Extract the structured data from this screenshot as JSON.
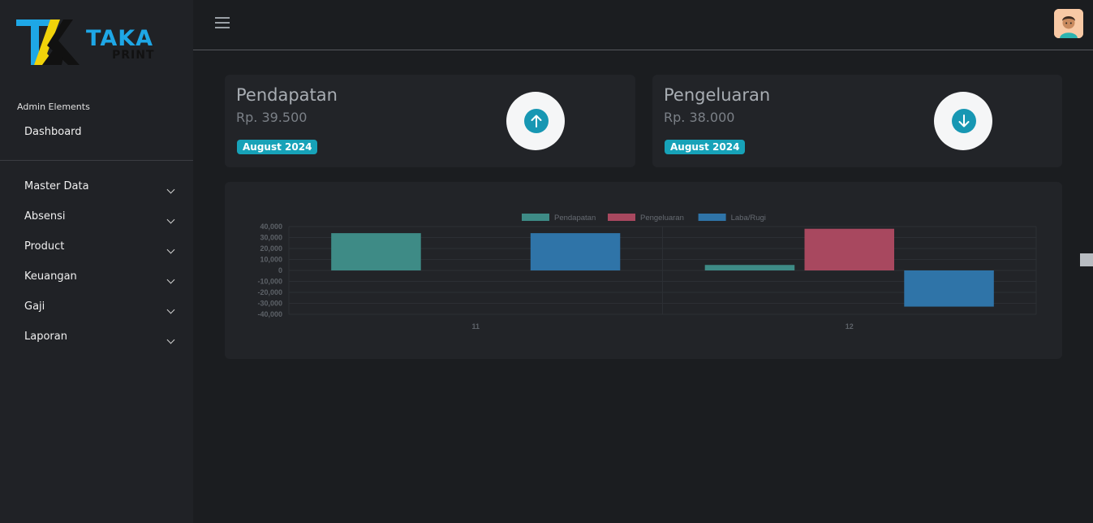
{
  "app": {
    "logo_text": "TAKA",
    "logo_sub": "PRINT"
  },
  "sidebar": {
    "section_title": "Admin Elements",
    "dashboard_label": "Dashboard",
    "items": [
      {
        "label": "Master Data"
      },
      {
        "label": "Absensi"
      },
      {
        "label": "Product"
      },
      {
        "label": "Keuangan"
      },
      {
        "label": "Gaji"
      },
      {
        "label": "Laporan"
      }
    ]
  },
  "cards": {
    "income": {
      "title": "Pendapatan",
      "value": "Rp. 39.500",
      "badge": "August 2024",
      "icon": "arrow-up-icon"
    },
    "expense": {
      "title": "Pengeluaran",
      "value": "Rp. 38.000",
      "badge": "August 2024",
      "icon": "arrow-down-icon"
    }
  },
  "colors": {
    "accent": "#17a2b8",
    "pendapatan": "#3e8b86",
    "pengeluaran": "#a8485f",
    "laba_rugi": "#2f74a8"
  },
  "chart_data": {
    "type": "bar",
    "categories": [
      "11",
      "12"
    ],
    "series": [
      {
        "name": "Pendapatan",
        "values": [
          34000,
          5000
        ]
      },
      {
        "name": "Pengeluaran",
        "values": [
          0,
          38000
        ]
      },
      {
        "name": "Laba/Rugi",
        "values": [
          34000,
          -33000
        ]
      }
    ],
    "ylim": [
      -40000,
      40000
    ],
    "yticks": [
      "40,000",
      "30,000",
      "20,000",
      "10,000",
      "0",
      "-10,000",
      "-20,000",
      "-30,000",
      "-40,000"
    ],
    "yticks_values": [
      40000,
      30000,
      20000,
      10000,
      0,
      -10000,
      -20000,
      -30000,
      -40000
    ],
    "legend": "top",
    "grid": true
  }
}
